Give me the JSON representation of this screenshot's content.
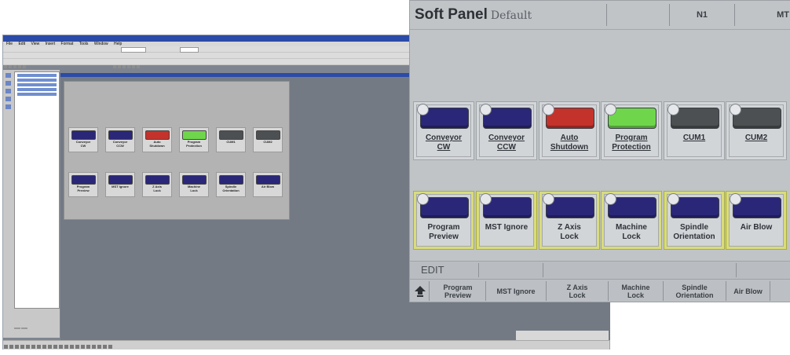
{
  "editor": {
    "menu": [
      "File",
      "Edit",
      "View",
      "Insert",
      "Format",
      "Tools",
      "Window",
      "Help"
    ]
  },
  "panel": {
    "title": "Soft Panel",
    "subtitle": "Default",
    "header_cells": [
      "",
      "N1",
      "MT"
    ],
    "top_row": [
      {
        "label": "Conveyor\nCW",
        "lamp": "#2b2778",
        "underline": true
      },
      {
        "label": "Conveyor\nCCW",
        "lamp": "#2b2778",
        "underline": true
      },
      {
        "label": "Auto\nShutdown",
        "lamp": "#c4322c",
        "underline": true
      },
      {
        "label": "Program\nProtection",
        "lamp": "#6fd64c",
        "underline": true
      },
      {
        "label": "CUM1",
        "lamp": "#4d5052",
        "underline": true
      },
      {
        "label": "CUM2",
        "lamp": "#4d5052",
        "underline": true
      }
    ],
    "bottom_row": [
      {
        "label": "Program\nPreview",
        "lamp": "#2b2778"
      },
      {
        "label": "MST Ignore",
        "lamp": "#2b2778"
      },
      {
        "label": "Z Axis\nLock",
        "lamp": "#2b2778"
      },
      {
        "label": "Machine\nLock",
        "lamp": "#2b2778"
      },
      {
        "label": "Spindle\nOrientation",
        "lamp": "#2b2778"
      },
      {
        "label": "Air Blow",
        "lamp": "#2b2778"
      }
    ],
    "mode_label": "EDIT",
    "softkeys": [
      "Program\nPreview",
      "MST Ignore",
      "Z Axis\nLock",
      "Machine\nLock",
      "Spindle\nOrientation",
      "Air Blow"
    ],
    "home_icon": "home-arrow-icon"
  },
  "mini_panel": {
    "top_row": [
      {
        "label": "Conveyor\nCW",
        "lamp": "#2b2778"
      },
      {
        "label": "Conveyor\nCCW",
        "lamp": "#2b2778"
      },
      {
        "label": "Auto\nShutdown",
        "lamp": "#c4322c"
      },
      {
        "label": "Program\nProtection",
        "lamp": "#6fd64c"
      },
      {
        "label": "CUM1",
        "lamp": "#4d5052"
      },
      {
        "label": "CUM2",
        "lamp": "#4d5052"
      }
    ],
    "bottom_row": [
      {
        "label": "Program\nPreview",
        "lamp": "#2b2778"
      },
      {
        "label": "MST Ignore",
        "lamp": "#2b2778"
      },
      {
        "label": "Z Axis\nLock",
        "lamp": "#2b2778"
      },
      {
        "label": "Machine\nLock",
        "lamp": "#2b2778"
      },
      {
        "label": "Spindle\nOrientation",
        "lamp": "#2b2778"
      },
      {
        "label": "Air Blow",
        "lamp": "#2b2778"
      }
    ]
  }
}
